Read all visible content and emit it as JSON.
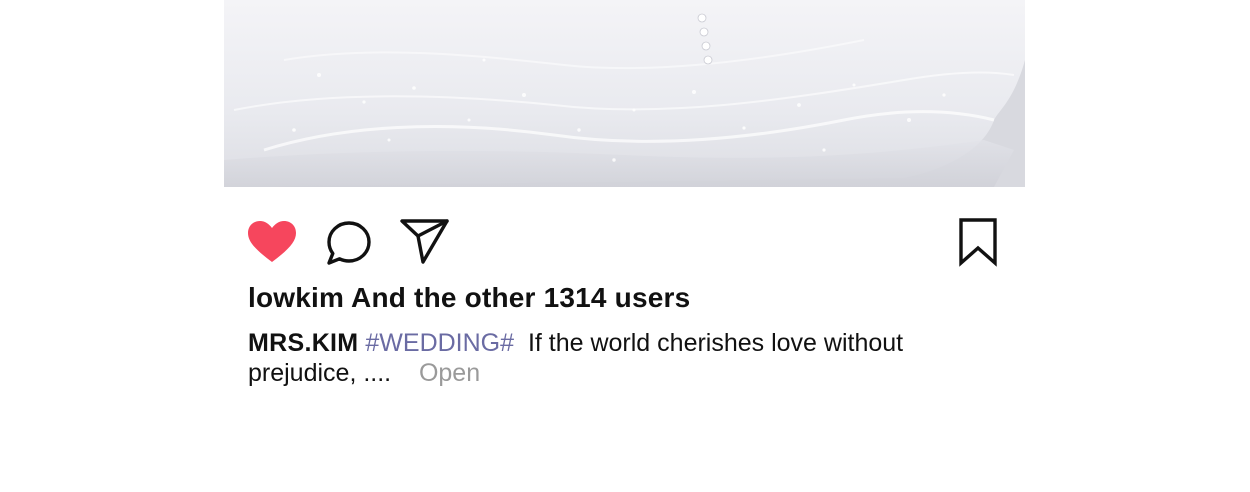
{
  "post": {
    "likes_text": "lowkim And the other 1314 users",
    "author": "MRS.KIM",
    "hashtag": "#WEDDING#",
    "caption_line1": "If the world cherishes love without",
    "caption_line2": "prejudice, ....",
    "open_label": "Open"
  },
  "icons": {
    "like": "heart-icon",
    "comment": "comment-bubble-icon",
    "share": "paper-plane-icon",
    "save": "bookmark-icon"
  },
  "colors": {
    "like_active": "#f6465d",
    "hashtag": "#6a6ba3",
    "open_link": "#9a9a9a",
    "text": "#111111"
  }
}
